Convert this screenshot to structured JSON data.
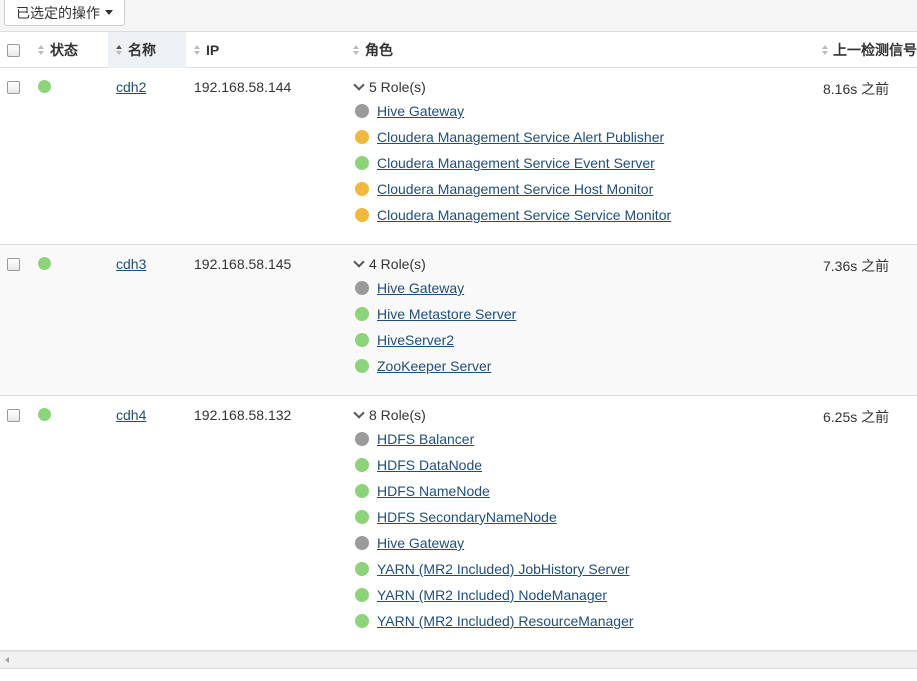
{
  "toolbar": {
    "actions_label": "已选定的操作"
  },
  "columns": {
    "status": "状态",
    "name": "名称",
    "ip": "IP",
    "roles": "角色",
    "last_heartbeat": "上一检测信号"
  },
  "status_colors": {
    "good": "#8cd37a",
    "warning": "#f0b93c",
    "stopped": "#9b9b9b"
  },
  "hosts": [
    {
      "name": "cdh2",
      "ip": "192.168.58.144",
      "status": "good",
      "roles_summary": "5 Role(s)",
      "heartbeat": "8.16s 之前",
      "roles": [
        {
          "label": "Hive Gateway",
          "status": "stopped"
        },
        {
          "label": "Cloudera Management Service Alert Publisher",
          "status": "warning"
        },
        {
          "label": "Cloudera Management Service Event Server",
          "status": "good"
        },
        {
          "label": "Cloudera Management Service Host Monitor",
          "status": "warning"
        },
        {
          "label": "Cloudera Management Service Service Monitor",
          "status": "warning"
        }
      ]
    },
    {
      "name": "cdh3",
      "ip": "192.168.58.145",
      "status": "good",
      "roles_summary": "4 Role(s)",
      "heartbeat": "7.36s 之前",
      "roles": [
        {
          "label": "Hive Gateway",
          "status": "stopped"
        },
        {
          "label": "Hive Metastore Server",
          "status": "good"
        },
        {
          "label": "HiveServer2",
          "status": "good"
        },
        {
          "label": "ZooKeeper Server",
          "status": "good"
        }
      ]
    },
    {
      "name": "cdh4",
      "ip": "192.168.58.132",
      "status": "good",
      "roles_summary": "8 Role(s)",
      "heartbeat": "6.25s 之前",
      "roles": [
        {
          "label": "HDFS Balancer",
          "status": "stopped"
        },
        {
          "label": "HDFS DataNode",
          "status": "good"
        },
        {
          "label": "HDFS NameNode",
          "status": "good"
        },
        {
          "label": "HDFS SecondaryNameNode",
          "status": "good"
        },
        {
          "label": "Hive Gateway",
          "status": "stopped"
        },
        {
          "label": "YARN (MR2 Included) JobHistory Server",
          "status": "good"
        },
        {
          "label": "YARN (MR2 Included) NodeManager",
          "status": "good"
        },
        {
          "label": "YARN (MR2 Included) ResourceManager",
          "status": "good"
        }
      ]
    }
  ]
}
